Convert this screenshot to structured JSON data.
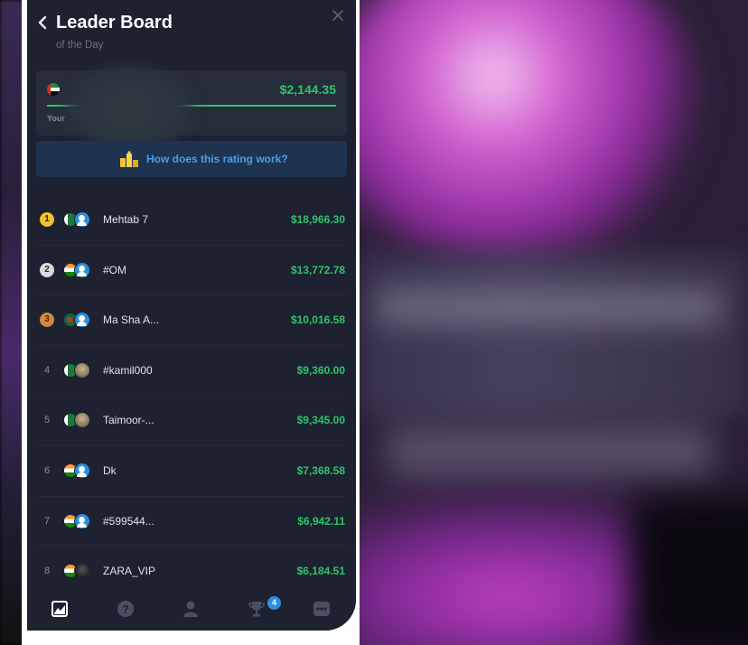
{
  "header": {
    "title": "Leader Board",
    "subtitle": "of the Day",
    "back_icon": "chevron-left-icon",
    "close_icon": "close-icon"
  },
  "my_position": {
    "flag": "UAE",
    "amount": "$2,144.35",
    "label": "Your",
    "progress": 1.0
  },
  "info": {
    "label": "How does this rating work?",
    "icon": "podium-icon"
  },
  "leaderboard": [
    {
      "rank": "1",
      "name": "Mehtab 7",
      "amount": "$18,966.30",
      "flag": "pk",
      "avatar": "blue",
      "medal": "gold"
    },
    {
      "rank": "2",
      "name": "#OM",
      "amount": "$13,772.78",
      "flag": "in",
      "avatar": "blue",
      "medal": "silver"
    },
    {
      "rank": "3",
      "name": "Ma Sha A...",
      "amount": "$10,016.58",
      "flag": "bd",
      "avatar": "blue",
      "medal": "bronze"
    },
    {
      "rank": "4",
      "name": "#kamil000",
      "amount": "$9,360.00",
      "flag": "pk",
      "avatar": "photo",
      "medal": ""
    },
    {
      "rank": "5",
      "name": "Taimoor-...",
      "amount": "$9,345.00",
      "flag": "pk",
      "avatar": "photo",
      "medal": ""
    },
    {
      "rank": "6",
      "name": "Dk",
      "amount": "$7,368.58",
      "flag": "in",
      "avatar": "blue",
      "medal": ""
    },
    {
      "rank": "7",
      "name": "#599544...",
      "amount": "$6,942.11",
      "flag": "in",
      "avatar": "blue",
      "medal": ""
    },
    {
      "rank": "8",
      "name": "ZARA_VIP",
      "amount": "$6,184.51",
      "flag": "in",
      "avatar": "dark",
      "medal": ""
    }
  ],
  "bottom_nav": {
    "items": [
      "chart-icon",
      "help-icon",
      "profile-icon",
      "trophy-icon",
      "more-icon"
    ],
    "trophy_badge": "4"
  },
  "colors": {
    "background": "#1d2130",
    "card": "#272c3b",
    "positive": "#2fc46a",
    "link": "#4a9fe6",
    "info_bg": "#1e3350"
  }
}
